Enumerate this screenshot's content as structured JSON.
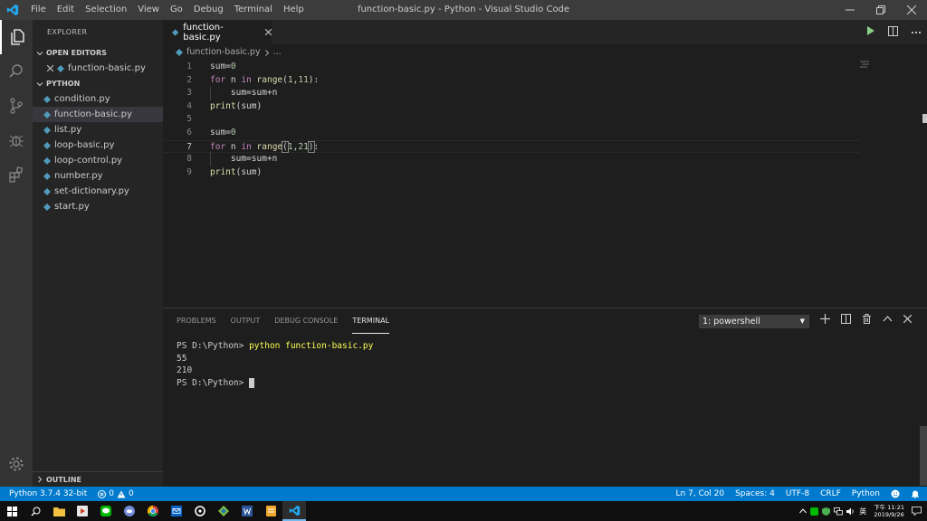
{
  "titlebar": {
    "menu": [
      "File",
      "Edit",
      "Selection",
      "View",
      "Go",
      "Debug",
      "Terminal",
      "Help"
    ],
    "title": "function-basic.py - Python - Visual Studio Code"
  },
  "sidebar": {
    "title": "EXPLORER",
    "open_editors_label": "OPEN EDITORS",
    "open_editors": [
      "function-basic.py"
    ],
    "folder_label": "PYTHON",
    "files": [
      "condition.py",
      "function-basic.py",
      "list.py",
      "loop-basic.py",
      "loop-control.py",
      "number.py",
      "set-dictionary.py",
      "start.py"
    ],
    "selected_file": "function-basic.py",
    "outline_label": "OUTLINE"
  },
  "editor": {
    "tab_label": "function-basic.py",
    "breadcrumb_file": "function-basic.py",
    "breadcrumb_more": "...",
    "lines": [
      {
        "n": "1",
        "text": "sum=0"
      },
      {
        "n": "2",
        "text": "for n in range(1,11):"
      },
      {
        "n": "3",
        "text": "    sum=sum+n"
      },
      {
        "n": "4",
        "text": "print(sum)"
      },
      {
        "n": "5",
        "text": ""
      },
      {
        "n": "6",
        "text": "sum=0"
      },
      {
        "n": "7",
        "text": "for n in range(1,21):"
      },
      {
        "n": "8",
        "text": "    sum=sum+n"
      },
      {
        "n": "9",
        "text": "print(sum)"
      }
    ]
  },
  "panel": {
    "tabs": [
      "PROBLEMS",
      "OUTPUT",
      "DEBUG CONSOLE",
      "TERMINAL"
    ],
    "active_tab": "TERMINAL",
    "terminal_select": "1: powershell",
    "terminal": {
      "prompt1": "PS D:\\Python> ",
      "command": "python function-basic.py",
      "out1": "55",
      "out2": "210",
      "prompt2": "PS D:\\Python> "
    }
  },
  "statusbar": {
    "interpreter": "Python 3.7.4 32-bit",
    "errors": "0",
    "warnings": "0",
    "position": "Ln 7, Col 20",
    "spaces": "Spaces: 4",
    "encoding": "UTF-8",
    "eol": "CRLF",
    "language": "Python"
  },
  "taskbar": {
    "time": "下午 11:21",
    "date": "2019/9/26",
    "ime": "英"
  },
  "colors": {
    "accent": "#007acc",
    "titlebar": "#3c3c3c",
    "activitybar": "#333333",
    "sidebar": "#252526",
    "editor": "#1e1e1e",
    "python_blue": "#519aba"
  }
}
